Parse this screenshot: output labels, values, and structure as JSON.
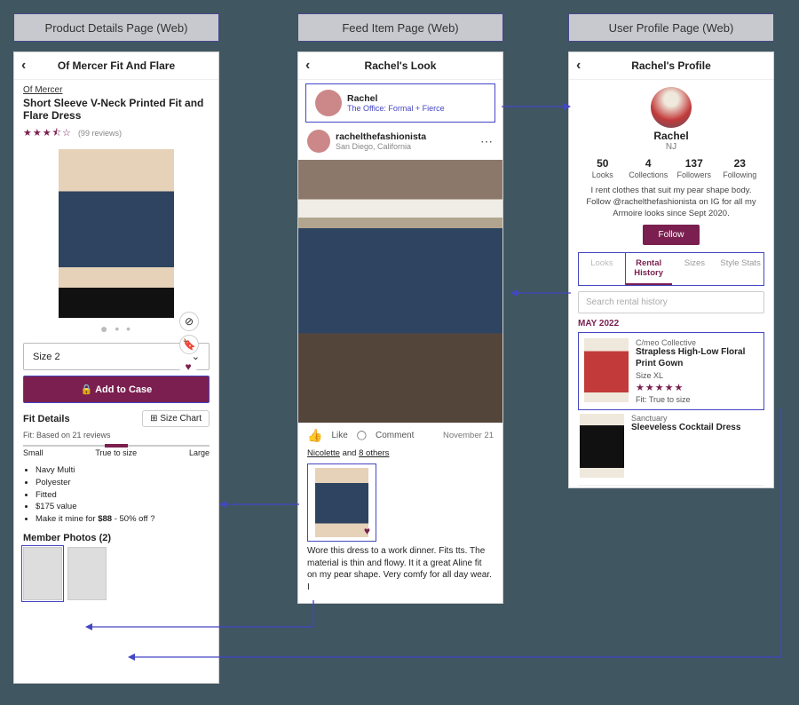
{
  "labels": {
    "c1": "Product Details Page (Web)",
    "c2": "Feed Item Page (Web)",
    "c3": "User Profile Page (Web)"
  },
  "product": {
    "header": "Of Mercer Fit And Flare",
    "brand": "Of Mercer",
    "title": "Short Sleeve V-Neck Printed Fit and Flare Dress",
    "stars": "★★★⯪☆",
    "reviews_label": "(99 reviews)",
    "size": "Size 2",
    "cta": "🔒  Add to Case",
    "fit_heading": "Fit Details",
    "size_chart_btn": "⊞ Size Chart",
    "fit_meta": "Fit: Based on 21 reviews",
    "sl_small": "Small",
    "sl_true": "True to size",
    "sl_large": "Large",
    "bullets": [
      "Navy Multi",
      "Polyester",
      "Fitted",
      "$175 value"
    ],
    "bullet_price_pre": "Make it mine for ",
    "bullet_price_bold": "$88",
    "bullet_price_post": " - 50% off     ?",
    "member_photos_heading": "Member Photos (2)"
  },
  "feed": {
    "header": "Rachel's Look",
    "top_name": "Rachel",
    "top_sub": "The Office: Formal + Fierce",
    "handle": "rachelthefashionista",
    "location": "San Diego, California",
    "like": "Like",
    "comment": "Comment",
    "date": "November 21",
    "liked_1": "Nicolette",
    "liked_mid": " and ",
    "liked_2": "8 others",
    "caption": "Wore this dress to a work dinner. Fits tts. The material is thin and flowy. It it a great Aline fit on my pear shape. Very comfy for all day wear. I"
  },
  "profile": {
    "header": "Rachel's Profile",
    "name": "Rachel",
    "loc": "NJ",
    "stats": [
      {
        "n": "50",
        "l": "Looks"
      },
      {
        "n": "4",
        "l": "Collections"
      },
      {
        "n": "137",
        "l": "Followers"
      },
      {
        "n": "23",
        "l": "Following"
      }
    ],
    "bio": "I rent clothes that suit my pear shape body. Follow @rachelthefashionista on IG for all my Armoire looks since Sept 2020.",
    "follow": "Follow",
    "tabs": [
      "Looks",
      "Rental History",
      "Sizes",
      "Style Stats"
    ],
    "search_ph": "Search rental history",
    "month": "MAY 2022",
    "rentals": [
      {
        "brand": "C/meo Collective",
        "name": "Strapless High-Low Floral Print Gown",
        "size": "Size XL",
        "stars": "★★★★★",
        "fit": "Fit: True to size"
      },
      {
        "brand": "Sanctuary",
        "name": "Sleeveless Cocktail Dress"
      }
    ]
  }
}
